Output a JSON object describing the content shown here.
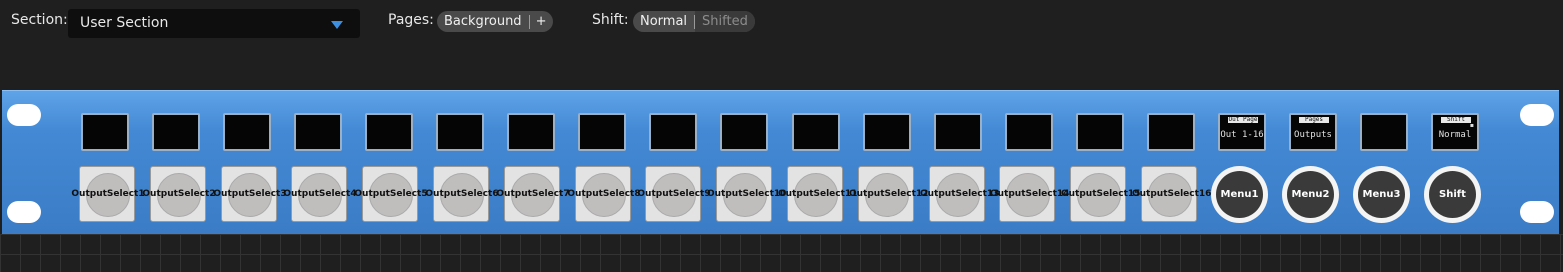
{
  "toolbar": {
    "section_label": "Section:",
    "section_value": "User Section",
    "pages_label": "Pages:",
    "pages_current": "Background",
    "pages_add": "+",
    "shift_label": "Shift:",
    "shift_normal": "Normal",
    "shift_shifted": "Shifted"
  },
  "colors": {
    "panel_blue": "#4389d4",
    "caret_blue": "#3c8fe0",
    "background": "#1f1f1f"
  },
  "lcds": [
    {
      "header": "",
      "value": ""
    },
    {
      "header": "",
      "value": ""
    },
    {
      "header": "",
      "value": ""
    },
    {
      "header": "",
      "value": ""
    },
    {
      "header": "",
      "value": ""
    },
    {
      "header": "",
      "value": ""
    },
    {
      "header": "",
      "value": ""
    },
    {
      "header": "",
      "value": ""
    },
    {
      "header": "",
      "value": ""
    },
    {
      "header": "",
      "value": ""
    },
    {
      "header": "",
      "value": ""
    },
    {
      "header": "",
      "value": ""
    },
    {
      "header": "",
      "value": ""
    },
    {
      "header": "",
      "value": ""
    },
    {
      "header": "",
      "value": ""
    },
    {
      "header": "",
      "value": ""
    },
    {
      "header": "Out Page",
      "value": "Out 1-16"
    },
    {
      "header": "Pages",
      "value": "Outputs"
    },
    {
      "header": "",
      "value": ""
    },
    {
      "header": "Shift",
      "value": "Normal"
    }
  ],
  "square_buttons": [
    "OutputSelect1",
    "OutputSelect2",
    "OutputSelect3",
    "OutputSelect4",
    "OutputSelect5",
    "OutputSelect6",
    "OutputSelect7",
    "OutputSelect8",
    "OutputSelect9",
    "OutputSelect10",
    "OutputSelect11",
    "OutputSelect12",
    "OutputSelect13",
    "OutputSelect14",
    "OutputSelect15",
    "OutputSelect16"
  ],
  "round_buttons": [
    "Menu1",
    "Menu2",
    "Menu3",
    "Shift"
  ]
}
